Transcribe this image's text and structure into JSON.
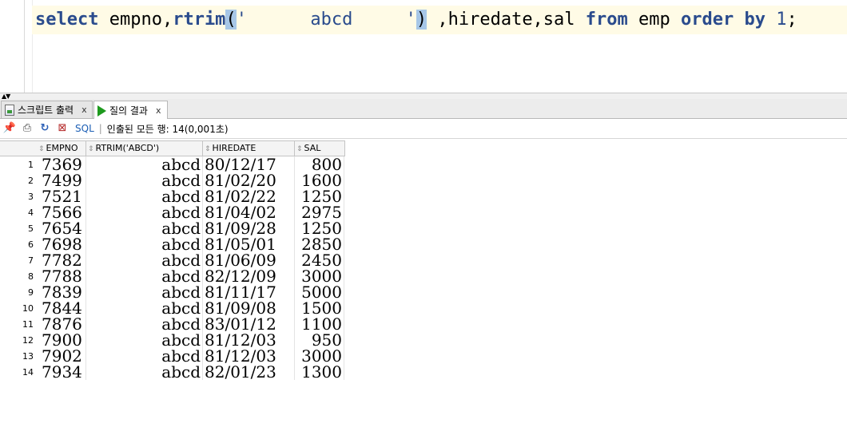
{
  "editor": {
    "tokens": [
      {
        "text": "select",
        "cls": "kw"
      },
      {
        "text": " empno,",
        "cls": ""
      },
      {
        "text": "rtrim",
        "cls": "fn"
      },
      {
        "text": "(",
        "cls": "paren"
      },
      {
        "text": "'      abcd     '",
        "cls": "str"
      },
      {
        "text": ")",
        "cls": "paren"
      },
      {
        "text": " ,hiredate,sal ",
        "cls": ""
      },
      {
        "text": "from",
        "cls": "kw"
      },
      {
        "text": " emp ",
        "cls": ""
      },
      {
        "text": "order by",
        "cls": "kw"
      },
      {
        "text": " ",
        "cls": ""
      },
      {
        "text": "1",
        "cls": "str"
      },
      {
        "text": ";",
        "cls": ""
      }
    ]
  },
  "tabs": {
    "script_output": {
      "label": "스크립트 출력",
      "close": "x"
    },
    "query_result": {
      "label": "질의 결과",
      "close": "x"
    }
  },
  "toolbar": {
    "sql_label": "SQL",
    "separator": "|",
    "status": "인출된 모든 행: 14(0,001초)"
  },
  "grid": {
    "columns": [
      "EMPNO",
      "RTRIM('ABCD')",
      "HIREDATE",
      "SAL"
    ],
    "rows": [
      {
        "n": "1",
        "empno": "7369",
        "rtrim": "abcd",
        "hiredate": "80/12/17",
        "sal": "800"
      },
      {
        "n": "2",
        "empno": "7499",
        "rtrim": "abcd",
        "hiredate": "81/02/20",
        "sal": "1600"
      },
      {
        "n": "3",
        "empno": "7521",
        "rtrim": "abcd",
        "hiredate": "81/02/22",
        "sal": "1250"
      },
      {
        "n": "4",
        "empno": "7566",
        "rtrim": "abcd",
        "hiredate": "81/04/02",
        "sal": "2975"
      },
      {
        "n": "5",
        "empno": "7654",
        "rtrim": "abcd",
        "hiredate": "81/09/28",
        "sal": "1250"
      },
      {
        "n": "6",
        "empno": "7698",
        "rtrim": "abcd",
        "hiredate": "81/05/01",
        "sal": "2850"
      },
      {
        "n": "7",
        "empno": "7782",
        "rtrim": "abcd",
        "hiredate": "81/06/09",
        "sal": "2450"
      },
      {
        "n": "8",
        "empno": "7788",
        "rtrim": "abcd",
        "hiredate": "82/12/09",
        "sal": "3000"
      },
      {
        "n": "9",
        "empno": "7839",
        "rtrim": "abcd",
        "hiredate": "81/11/17",
        "sal": "5000"
      },
      {
        "n": "10",
        "empno": "7844",
        "rtrim": "abcd",
        "hiredate": "81/09/08",
        "sal": "1500"
      },
      {
        "n": "11",
        "empno": "7876",
        "rtrim": "abcd",
        "hiredate": "83/01/12",
        "sal": "1100"
      },
      {
        "n": "12",
        "empno": "7900",
        "rtrim": "abcd",
        "hiredate": "81/12/03",
        "sal": "950"
      },
      {
        "n": "13",
        "empno": "7902",
        "rtrim": "abcd",
        "hiredate": "81/12/03",
        "sal": "3000"
      },
      {
        "n": "14",
        "empno": "7934",
        "rtrim": "abcd",
        "hiredate": "82/01/23",
        "sal": "1300"
      }
    ]
  },
  "colors": {
    "keyword": "#2a4b8d",
    "paren_highlight": "#a7c7e7",
    "line_highlight": "#fffbe6",
    "sql_link": "#1c5fb5",
    "run_icon": "#1e9a1e"
  },
  "icons": [
    "pin-icon",
    "print-icon",
    "refresh-icon",
    "export-icon",
    "script-doc-icon",
    "run-play-icon",
    "sort-icon"
  ]
}
